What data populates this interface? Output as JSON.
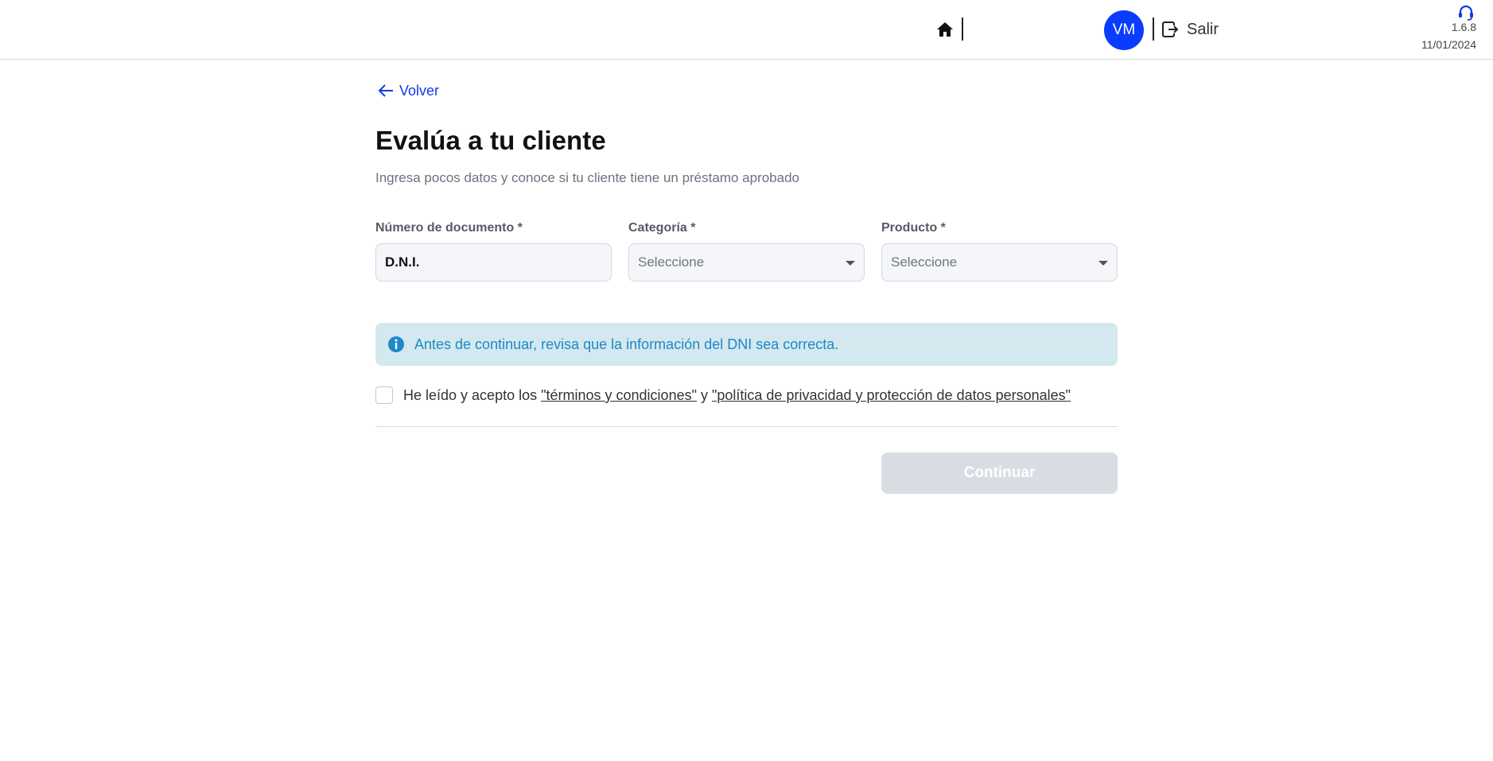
{
  "header": {
    "home_icon": "home-icon",
    "avatar_initials": "VM",
    "avatar_color": "#0a3cff",
    "logout_label": "Salir",
    "logout_icon": "logout-icon",
    "support_icon": "headset-icon",
    "version": "1.6.8",
    "date": "11/01/2024"
  },
  "main": {
    "back_label": "Volver",
    "title": "Evalúa a tu cliente",
    "subtitle": "Ingresa pocos datos y conoce si tu cliente tiene un préstamo aprobado",
    "fields": {
      "document": {
        "label": "Número de documento *",
        "value": "D.N.I."
      },
      "category": {
        "label": "Categoría *",
        "placeholder": "Seleccione"
      },
      "product": {
        "label": "Producto *",
        "placeholder": "Seleccione"
      }
    },
    "info_banner": "Antes de continuar, revisa que la información del DNI sea correcta.",
    "terms": {
      "prefix": "He leído y acepto los ",
      "terms_link": "\"términos y condiciones\"",
      "conjunction": " y ",
      "privacy_link": "\"política de privacidad y protección de datos personales\"",
      "checked": false
    },
    "continue_label": "Continuar"
  },
  "colors": {
    "accent": "#1539e6",
    "info_bg": "#d3e9ef",
    "info_text": "#1e88c8",
    "disabled_button": "#d8dde3"
  }
}
